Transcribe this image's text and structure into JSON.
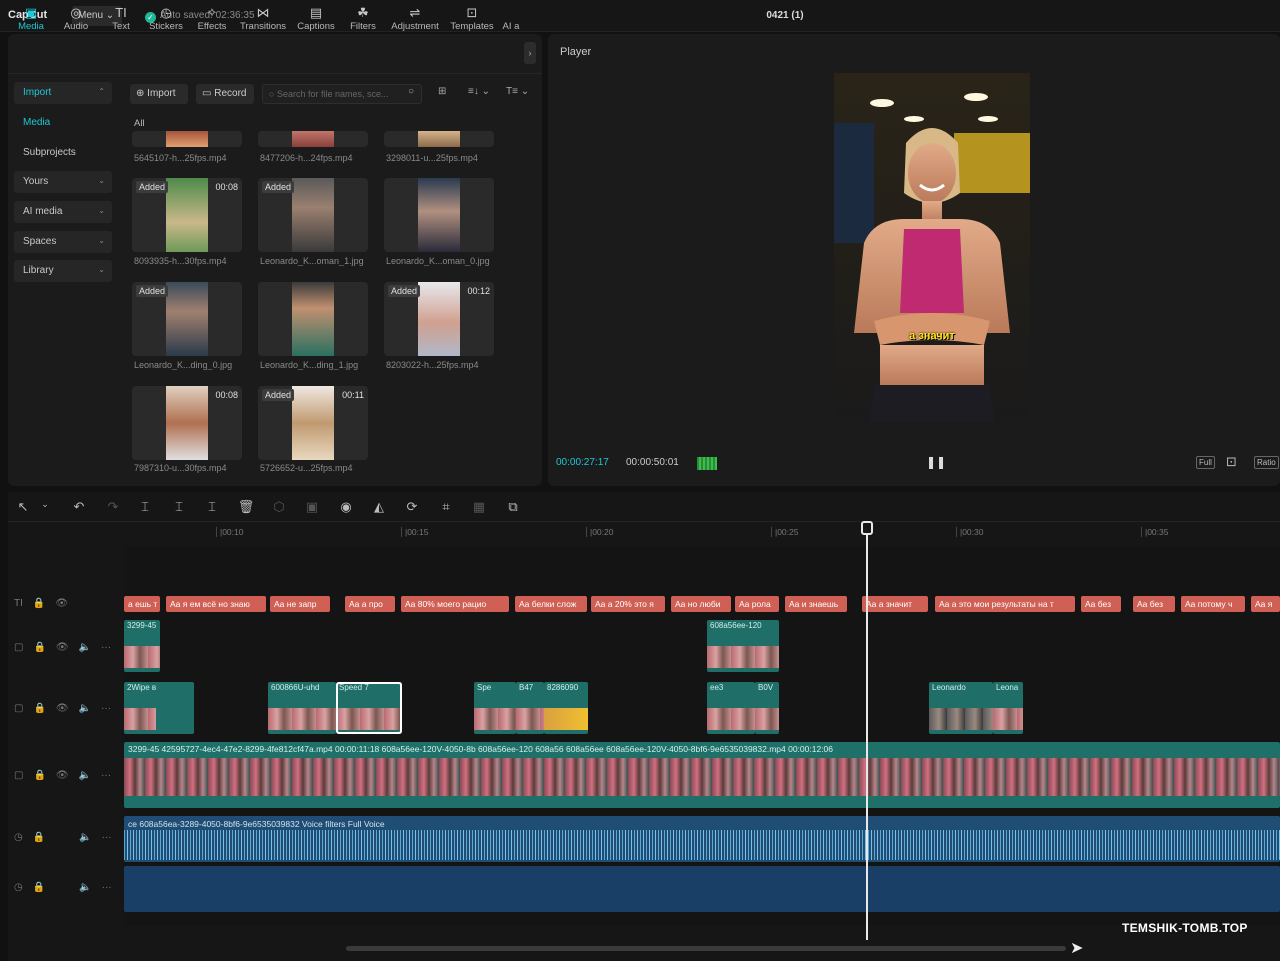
{
  "topbar": {
    "logo": "CapCut",
    "menu": "Menu ⌄",
    "autosave": "Auto saved: 02:36:35",
    "title": "0421 (1)"
  },
  "tooltabs": [
    {
      "label": "Media",
      "icon": "▣"
    },
    {
      "label": "Audio",
      "icon": "◎"
    },
    {
      "label": "Text",
      "icon": "TI"
    },
    {
      "label": "Stickers",
      "icon": "◷"
    },
    {
      "label": "Effects",
      "icon": "✧"
    },
    {
      "label": "Transitions",
      "icon": "⋈"
    },
    {
      "label": "Captions",
      "icon": "▤"
    },
    {
      "label": "Filters",
      "icon": "☘"
    },
    {
      "label": "Adjustment",
      "icon": "⇌"
    },
    {
      "label": "Templates",
      "icon": "⊡"
    },
    {
      "label": "AI a",
      "icon": ""
    }
  ],
  "sidebar": [
    {
      "label": "Import",
      "chev": "⌃"
    },
    {
      "label": "Media",
      "chev": ""
    },
    {
      "label": "Subprojects",
      "chev": ""
    },
    {
      "label": "Yours",
      "chev": "⌄"
    },
    {
      "label": "AI media",
      "chev": "⌄"
    },
    {
      "label": "Spaces",
      "chev": "⌄"
    },
    {
      "label": "Library",
      "chev": "⌄"
    }
  ],
  "media_toolbar": {
    "import": "Import",
    "record": "Record",
    "search_placeholder": "Search for file names, sce...",
    "all": "All",
    "grid_icon": "⊞",
    "sort_icon": "≡↓ ⌄",
    "filter_icon": "T≡ ⌄"
  },
  "media": [
    {
      "name": "5645107-h...25fps.mp4",
      "badge": "",
      "dur": ""
    },
    {
      "name": "8477206-h...24fps.mp4",
      "badge": "",
      "dur": ""
    },
    {
      "name": "3298011-u...25fps.mp4",
      "badge": "",
      "dur": ""
    },
    {
      "name": "8093935-h...30fps.mp4",
      "badge": "Added",
      "dur": "00:08"
    },
    {
      "name": "Leonardo_K...oman_1.jpg",
      "badge": "Added",
      "dur": ""
    },
    {
      "name": "Leonardo_K...oman_0.jpg",
      "badge": "",
      "dur": ""
    },
    {
      "name": "Leonardo_K...ding_0.jpg",
      "badge": "Added",
      "dur": ""
    },
    {
      "name": "Leonardo_K...ding_1.jpg",
      "badge": "",
      "dur": ""
    },
    {
      "name": "8203022-h...25fps.mp4",
      "badge": "Added",
      "dur": "00:12"
    },
    {
      "name": "7987310-u...30fps.mp4",
      "badge": "",
      "dur": "00:08"
    },
    {
      "name": "5726652-u...25fps.mp4",
      "badge": "Added",
      "dur": "00:11"
    }
  ],
  "player": {
    "title": "Player",
    "subtitle": "а значит",
    "time_current": "00:00:27:17",
    "time_total": "00:00:50:01",
    "pause": "❚❚",
    "full": "Full",
    "ratio": "Ratio"
  },
  "timeline": {
    "ruler": [
      "|00:10",
      "|00:15",
      "|00:20",
      "|00:25",
      "|00:30",
      "|00:35"
    ],
    "text_clips": [
      "а ешь т",
      "Aa я ем всё но знаю",
      "Aa не запр",
      "Aa а про",
      "Aa 80% моего рацио",
      "Aa белки слож",
      "Aa а 20% это я",
      "Aa но люби",
      "Aa рола",
      "Aa и знаешь",
      "Aa а значит",
      "Aa а это мои результаты на т",
      "Aa без",
      "Aa без",
      "Aa потому ч",
      "Aa я"
    ],
    "overlay_labels": [
      "3299-45",
      "608a56ee-120",
      "2Wipe в",
      "600866U-uhd",
      "Speed 7",
      "Spe",
      "B47",
      "8286090",
      "ee3",
      "B0V",
      "Leonardo",
      "Leona"
    ],
    "main_label": "3299-45  42595727-4ec4-47e2-8299-4fe812cf47a.mp4  00:00:11:18        608a56ee-120V-4050-8b   608a56ee-120   608a56   608a56ee   608a56ee-120V-4050-8bf6-9e6535039832.mp4  00:00:12:06",
    "audio_label": "ce                                                                                                                    608a56ea-3289-4050-8bf6-9e6535039832    Voice filters Full Voice",
    "watermark": "TEMSHIK-TOMB.TOP"
  }
}
